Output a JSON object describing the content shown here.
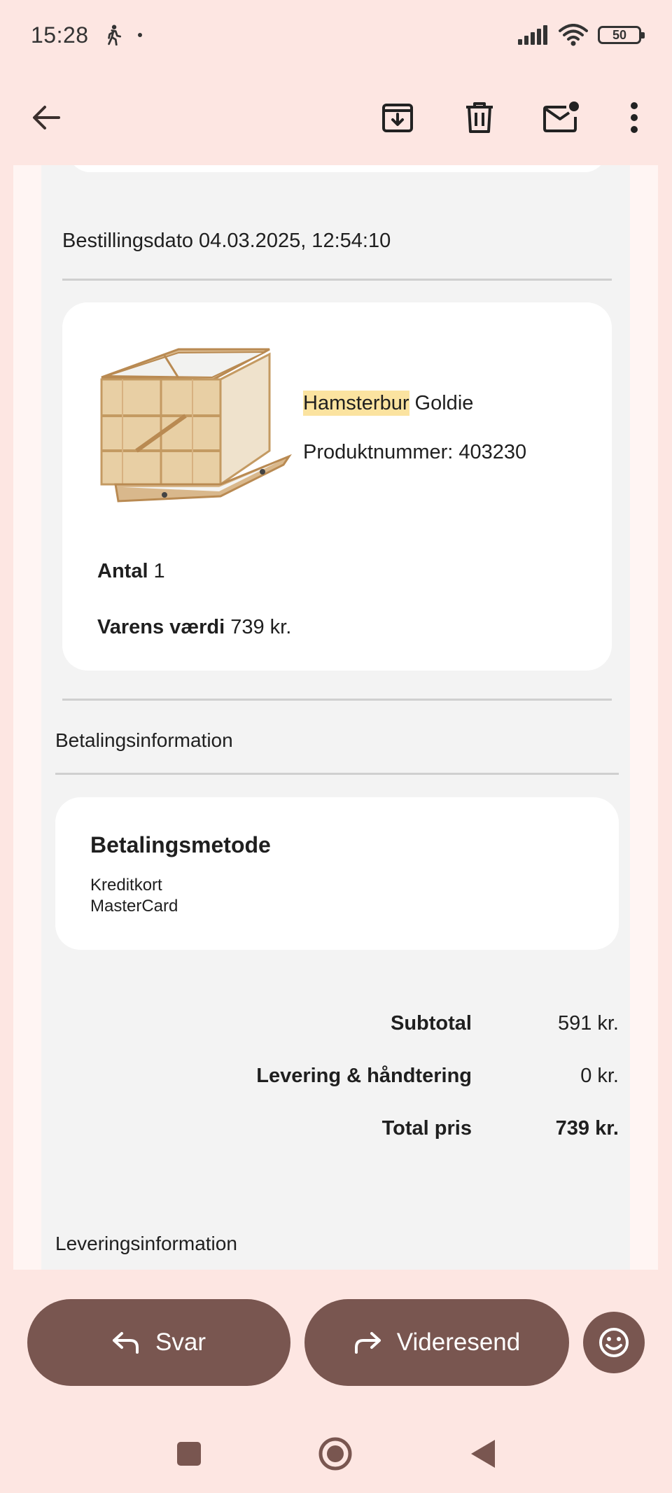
{
  "status_bar": {
    "time": "15:28",
    "battery": "50",
    "icons": [
      "walk-icon",
      "signal-icon",
      "wifi-icon",
      "battery-icon"
    ]
  },
  "app_bar": {
    "icons": [
      "back-arrow-icon",
      "archive-icon",
      "trash-icon",
      "mark-unread-icon",
      "more-vert-icon"
    ]
  },
  "order": {
    "date_line": "Bestillingsdato 04.03.2025, 12:54:10",
    "product": {
      "name_highlight": "Hamsterbur",
      "name_rest": " Goldie",
      "number_line": "Produktnummer: 403230",
      "quantity_label": "Antal",
      "quantity_value": " 1",
      "value_label": "Varens værdi",
      "value_value": " 739 kr."
    }
  },
  "payment": {
    "section_title": "Betalingsinformation",
    "card_title": "Betalingsmetode",
    "method_type": "Kreditkort",
    "method_brand": "MasterCard"
  },
  "totals": [
    {
      "label": "Subtotal",
      "value": "591 kr.",
      "bold": false
    },
    {
      "label": "Levering & håndtering",
      "value": "0 kr.",
      "bold": false
    },
    {
      "label": "Total pris",
      "value": "739 kr.",
      "bold": true
    }
  ],
  "delivery": {
    "section_title": "Leveringsinformation"
  },
  "actions": {
    "reply_label": "Svar",
    "forward_label": "Videresend"
  },
  "colors": {
    "background": "#fde6e2",
    "action_button": "#795650",
    "highlight": "#fbe3a0"
  }
}
